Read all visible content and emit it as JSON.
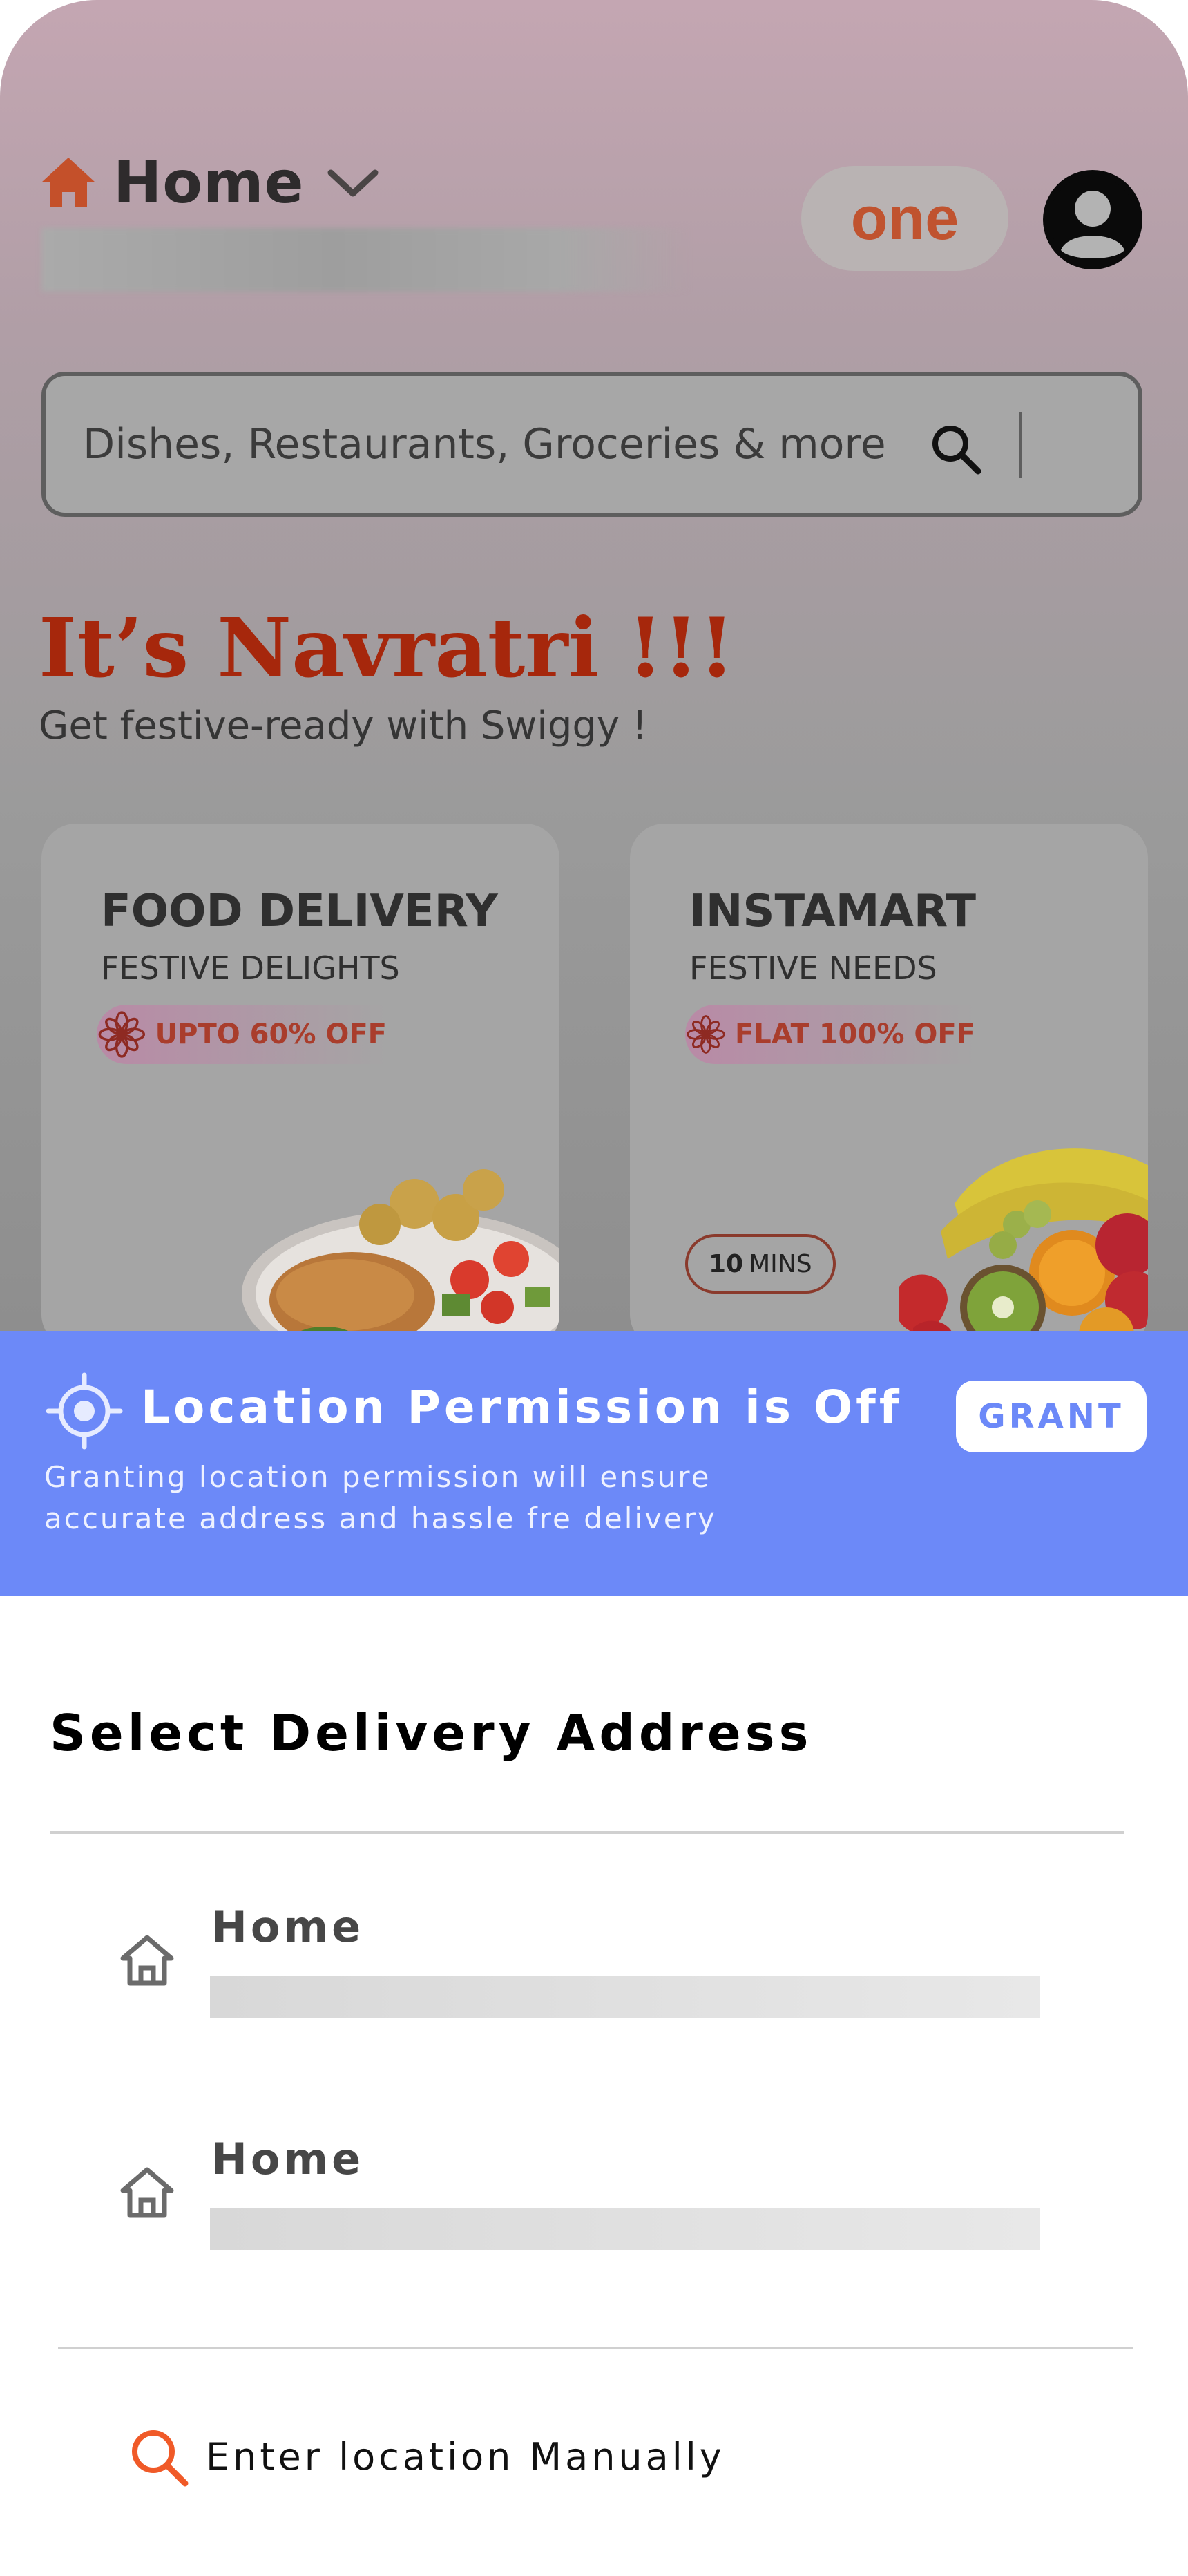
{
  "header": {
    "location_label": "Home",
    "one_badge": "one"
  },
  "search": {
    "placeholder": "Dishes, Restaurants, Groceries & more"
  },
  "festival": {
    "title": "It’s Navratri !!!",
    "subtitle": "Get festive-ready with Swiggy !"
  },
  "cards": {
    "food": {
      "title": "FOOD DELIVERY",
      "subtitle": "FESTIVE DELIGHTS",
      "offer": "UPTO 60% OFF"
    },
    "instamart": {
      "title": "INSTAMART",
      "subtitle": "FESTIVE NEEDS",
      "offer": "FLAT 100%  OFF",
      "eta_value": "10",
      "eta_unit": "MINS"
    }
  },
  "permission_banner": {
    "title": "Location Permission is Off",
    "description": "Granting location permission will ensure accurate address and hassle fre delivery",
    "grant_label": "GRANT",
    "background_color": "#6c89f8"
  },
  "sheet": {
    "title": "Select Delivery Address",
    "addresses": [
      {
        "label": "Home",
        "icon": "home-outline-icon"
      },
      {
        "label": "Home",
        "icon": "home-outline-icon"
      }
    ],
    "manual_label": "Enter location Manually",
    "manual_icon": "search-icon"
  },
  "colors": {
    "accent_orange": "#f05a28",
    "festive_red": "#a6270c"
  }
}
